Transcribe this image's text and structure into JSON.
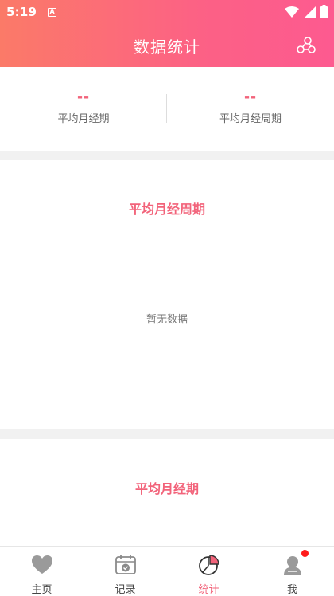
{
  "status_bar": {
    "time": "5:19",
    "notif_badge": "A"
  },
  "header": {
    "title": "数据统计"
  },
  "summary": {
    "left": {
      "value": "--",
      "label": "平均月经期"
    },
    "right": {
      "value": "--",
      "label": "平均月经周期"
    }
  },
  "cycle_card": {
    "title": "平均月经周期",
    "empty_text": "暂无数据"
  },
  "period_card": {
    "title": "平均月经期"
  },
  "tabs": [
    {
      "label": "主页",
      "icon": "heart-icon"
    },
    {
      "label": "记录",
      "icon": "calendar-icon"
    },
    {
      "label": "统计",
      "icon": "pie-chart-icon",
      "active": true
    },
    {
      "label": "我",
      "icon": "user-icon",
      "badge": true
    }
  ],
  "colors": {
    "accent": "#f2637a",
    "header_start": "#fb7a68",
    "header_end": "#fd5a90"
  }
}
